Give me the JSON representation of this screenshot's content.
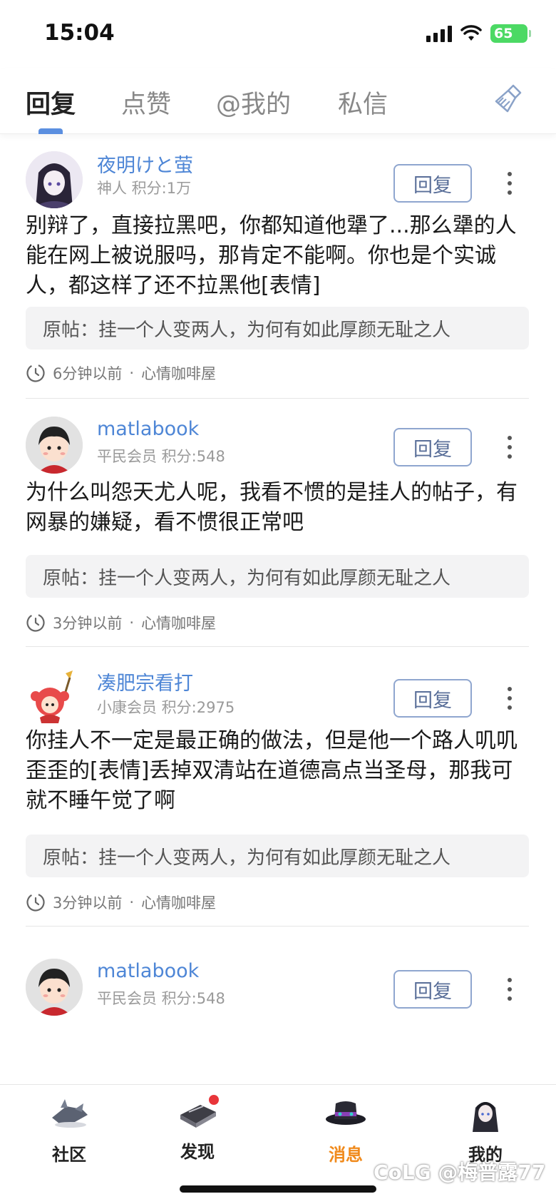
{
  "status_bar": {
    "time": "15:04",
    "battery": "65"
  },
  "tabs": [
    {
      "label": "回复",
      "active": true
    },
    {
      "label": "点赞",
      "active": false
    },
    {
      "label": "@我的",
      "active": false
    },
    {
      "label": "私信",
      "active": false
    }
  ],
  "clear_icon": "broom-icon",
  "origin_prefix": "原帖：",
  "reply_label": "回复",
  "meta_separator": "·",
  "comments": [
    {
      "user": "夜明けと萤",
      "meta": "神人 积分:1万",
      "text": "别辩了，直接拉黑吧，你都知道他犟了...那么犟的人能在网上被说服吗，那肯定不能啊。你也是个实诚人，都这样了还不拉黑他[表情]",
      "origin": "挂一个人变两人，为何有如此厚颜无耻之人",
      "time": "6分钟以前",
      "forum": "心情咖啡屋"
    },
    {
      "user": "matlabook",
      "meta": "平民会员 积分:548",
      "text": "为什么叫怨天尤人呢，我看不惯的是挂人的帖子，有网暴的嫌疑，看不惯很正常吧",
      "origin": "挂一个人变两人，为何有如此厚颜无耻之人",
      "time": "3分钟以前",
      "forum": "心情咖啡屋"
    },
    {
      "user": "凑肥宗看打",
      "meta": "小康会员 积分:2975",
      "text": "你挂人不一定是最正确的做法，但是他一个路人叽叽歪歪的[表情]丢掉双清站在道德高点当圣母，那我可就不睡午觉了啊",
      "origin": "挂一个人变两人，为何有如此厚颜无耻之人",
      "time": "3分钟以前",
      "forum": "心情咖啡屋"
    },
    {
      "user": "matlabook",
      "meta": "平民会员 积分:548"
    }
  ],
  "bottom_nav": [
    {
      "label": "社区",
      "icon": "community-icon",
      "active": false
    },
    {
      "label": "发现",
      "icon": "discover-icon",
      "active": false,
      "badge": true
    },
    {
      "label": "消息",
      "icon": "message-icon",
      "active": true
    },
    {
      "label": "我的",
      "icon": "profile-icon",
      "active": false
    }
  ],
  "watermark": "CoLG @梅普露77",
  "colors": {
    "accent": "#4e86d6",
    "active_nav": "#f08a1c",
    "badge": "#e8353a",
    "battery": "#4cd964"
  }
}
